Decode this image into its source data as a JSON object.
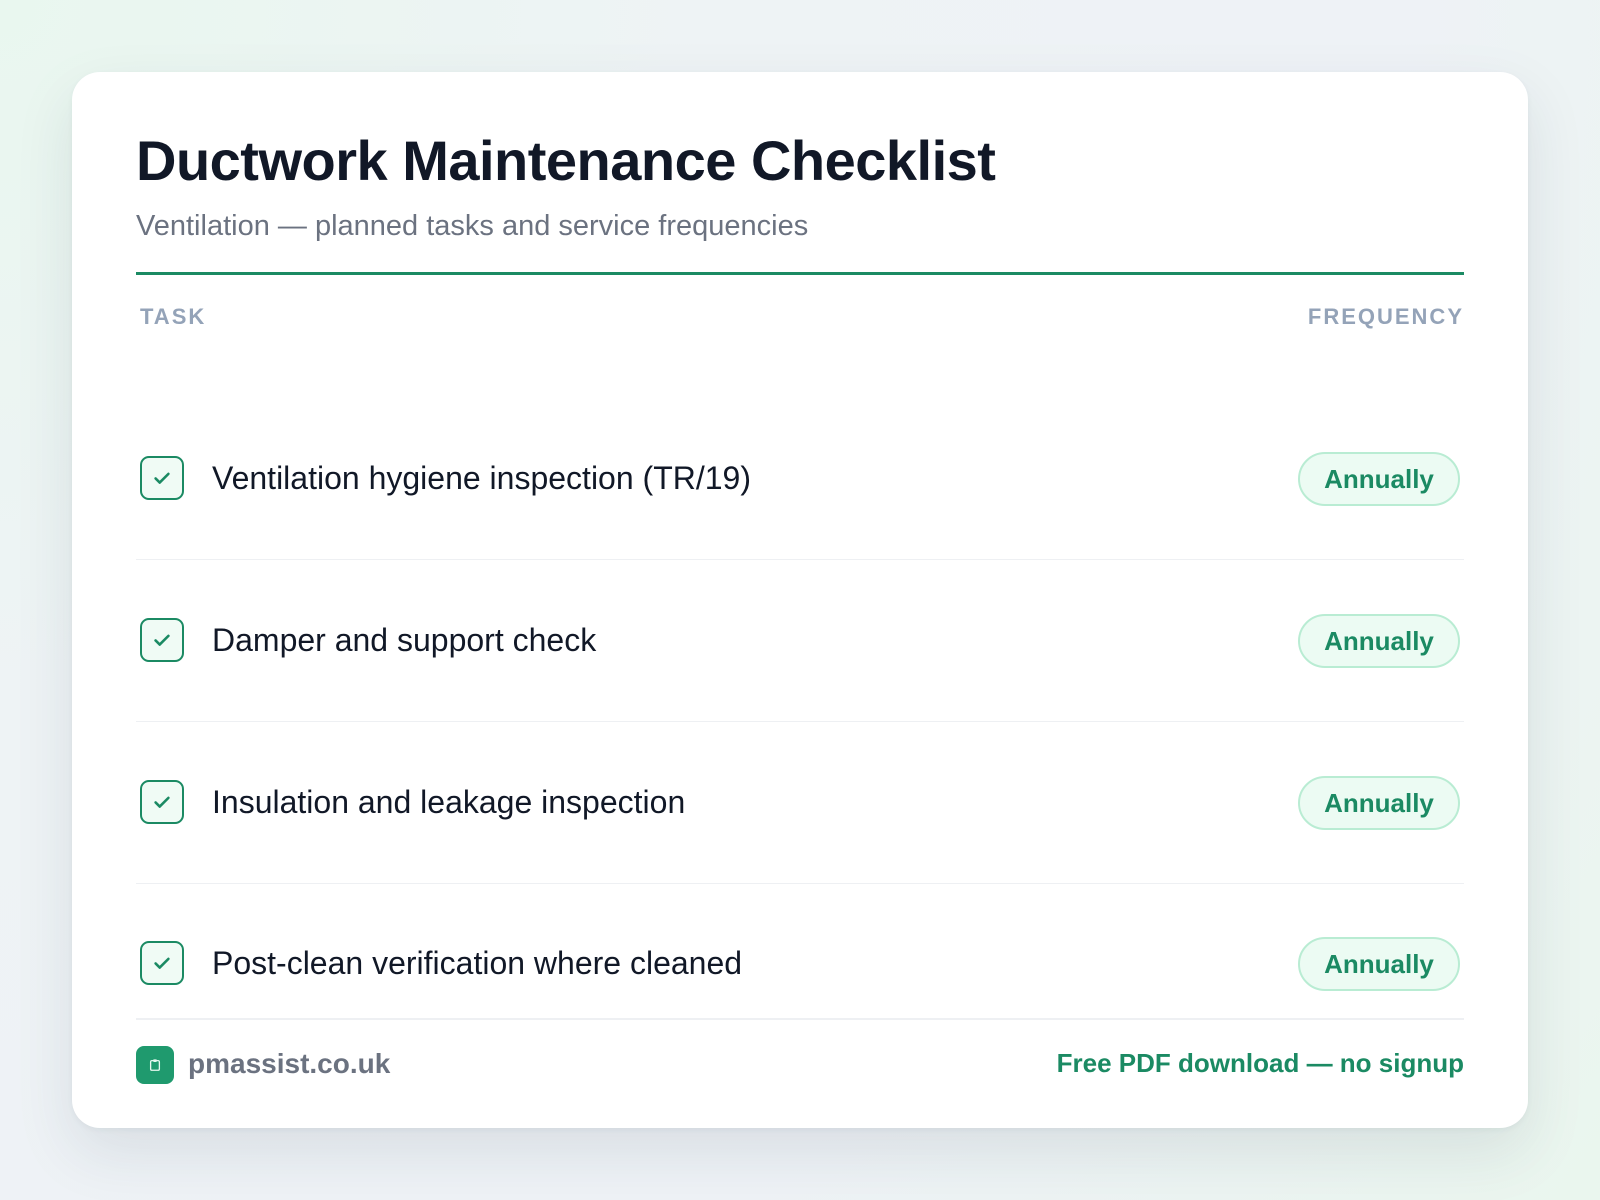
{
  "header": {
    "title": "Ductwork Maintenance Checklist",
    "subtitle": "Ventilation — planned tasks and service frequencies"
  },
  "columns": {
    "task": "TASK",
    "frequency": "FREQUENCY"
  },
  "tasks": [
    {
      "label": "Ventilation hygiene inspection (TR/19)",
      "frequency": "Annually",
      "checked": true
    },
    {
      "label": "Damper and support check",
      "frequency": "Annually",
      "checked": true
    },
    {
      "label": "Insulation and leakage inspection",
      "frequency": "Annually",
      "checked": true
    },
    {
      "label": "Post-clean verification where cleaned",
      "frequency": "Annually",
      "checked": true
    }
  ],
  "footer": {
    "site": "pmassist.co.uk",
    "cta": "Free PDF download — no signup"
  },
  "colors": {
    "accent": "#1b8a63",
    "pill_bg": "#ecfbf3",
    "pill_border": "#b9ecd3",
    "title": "#111827",
    "muted": "#6b7280"
  },
  "icons": {
    "checkbox": "checkmark-icon",
    "logo": "clipboard-logo-icon"
  }
}
